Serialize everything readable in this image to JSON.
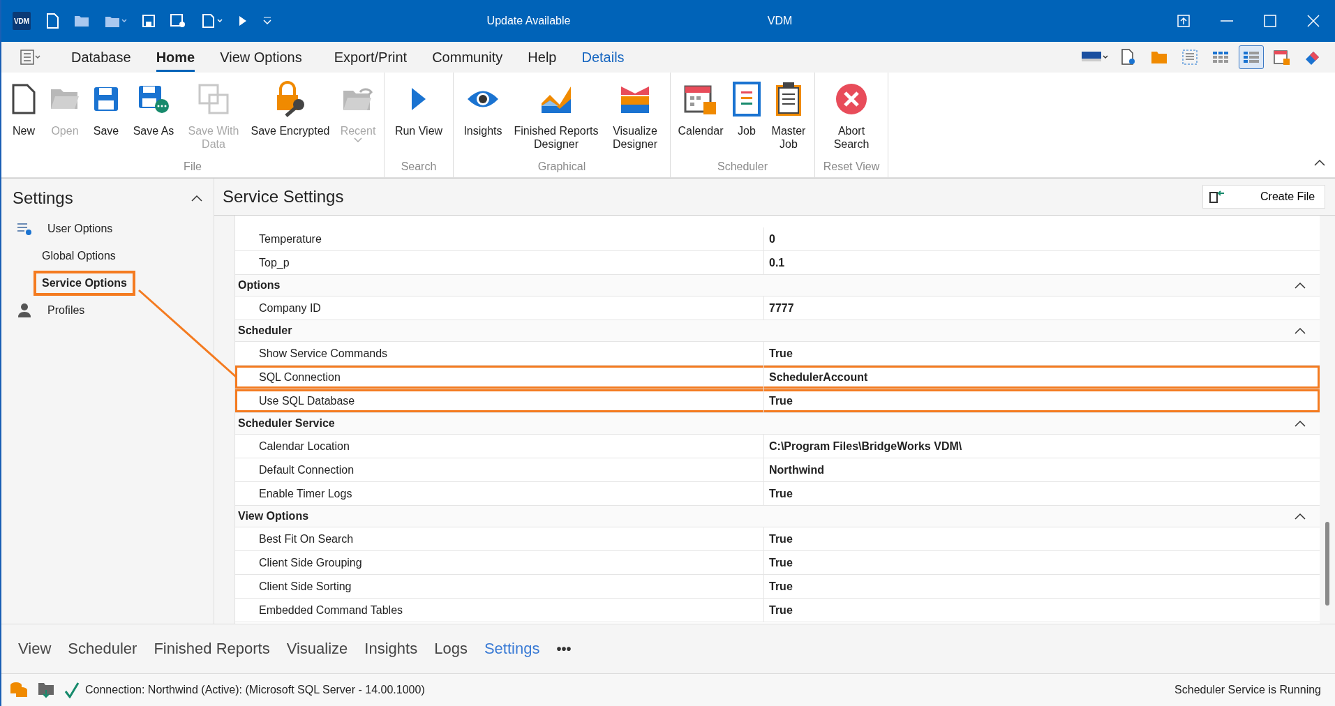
{
  "window": {
    "logo": "VDM",
    "notice": "Update Available",
    "title": "VDM"
  },
  "menu_tabs": [
    {
      "label": "Database",
      "selected": false,
      "kind": "normal"
    },
    {
      "label": "Home",
      "selected": true,
      "kind": "normal"
    },
    {
      "label": "View Options",
      "selected": false,
      "kind": "normal"
    },
    {
      "label": "Export/Print",
      "selected": false,
      "kind": "normal"
    },
    {
      "label": "Community",
      "selected": false,
      "kind": "normal"
    },
    {
      "label": "Help",
      "selected": false,
      "kind": "normal"
    },
    {
      "label": "Details",
      "selected": false,
      "kind": "contextual"
    }
  ],
  "ribbon": [
    {
      "label": "File",
      "buttons": [
        {
          "label": "New",
          "disabled": false
        },
        {
          "label": "Open",
          "disabled": true
        },
        {
          "label": "Save",
          "disabled": false
        },
        {
          "label": "Save As",
          "disabled": false
        },
        {
          "label": "Save With Data",
          "disabled": true
        },
        {
          "label": "Save Encrypted",
          "disabled": false
        },
        {
          "label": "Recent",
          "disabled": true
        }
      ]
    },
    {
      "label": "Search",
      "buttons": [
        {
          "label": "Run View",
          "disabled": false
        }
      ]
    },
    {
      "label": "Graphical",
      "buttons": [
        {
          "label": "Insights",
          "disabled": false
        },
        {
          "label": "Finished Reports Designer",
          "disabled": false
        },
        {
          "label": "Visualize Designer",
          "disabled": false
        }
      ]
    },
    {
      "label": "Scheduler",
      "buttons": [
        {
          "label": "Calendar",
          "disabled": false
        },
        {
          "label": "Job",
          "disabled": false
        },
        {
          "label": "Master Job",
          "disabled": false
        }
      ]
    },
    {
      "label": "Reset View",
      "buttons": [
        {
          "label": "Abort Search",
          "disabled": false
        }
      ]
    }
  ],
  "sidebar": {
    "title": "Settings",
    "items": [
      {
        "label": "User Options",
        "selected": false,
        "children": [
          {
            "label": "Global Options",
            "selected": false
          },
          {
            "label": "Service Options",
            "selected": true
          }
        ]
      },
      {
        "label": "Profiles",
        "selected": false
      }
    ]
  },
  "panel": {
    "title": "Service Settings",
    "create_button": "Create File",
    "groups": [
      {
        "rows": [
          {
            "name": "Temperature",
            "value": "0",
            "highlighted": false
          },
          {
            "name": "Top_p",
            "value": "0.1",
            "highlighted": false
          }
        ]
      },
      {
        "label": "Options",
        "rows": [
          {
            "name": "Company ID",
            "value": "7777",
            "highlighted": false
          }
        ]
      },
      {
        "label": "Scheduler",
        "rows": [
          {
            "name": "Show Service Commands",
            "value": "True",
            "highlighted": false
          },
          {
            "name": "SQL Connection",
            "value": "SchedulerAccount",
            "highlighted": true
          },
          {
            "name": "Use SQL Database",
            "value": "True",
            "highlighted": true
          }
        ]
      },
      {
        "label": "Scheduler Service",
        "rows": [
          {
            "name": "Calendar Location",
            "value": "C:\\Program Files\\BridgeWorks VDM\\",
            "highlighted": false
          },
          {
            "name": "Default Connection",
            "value": "Northwind",
            "highlighted": false
          },
          {
            "name": "Enable Timer Logs",
            "value": "True",
            "highlighted": false
          }
        ]
      },
      {
        "label": "View Options",
        "rows": [
          {
            "name": "Best Fit On Search",
            "value": "True",
            "highlighted": false
          },
          {
            "name": "Client Side Grouping",
            "value": "True",
            "highlighted": false
          },
          {
            "name": "Client Side Sorting",
            "value": "True",
            "highlighted": false
          },
          {
            "name": "Embedded Command Tables",
            "value": "True",
            "highlighted": false
          }
        ]
      }
    ]
  },
  "bottom_tabs": [
    {
      "label": "View",
      "selected": false
    },
    {
      "label": "Scheduler",
      "selected": false
    },
    {
      "label": "Finished Reports",
      "selected": false
    },
    {
      "label": "Visualize",
      "selected": false
    },
    {
      "label": "Insights",
      "selected": false
    },
    {
      "label": "Logs",
      "selected": false
    },
    {
      "label": "Settings",
      "selected": true
    }
  ],
  "more_button": "•••",
  "status_bar": {
    "connection": "Connection: Northwind (Active): (Microsoft SQL Server - 14.00.1000)",
    "service": "Scheduler Service is Running"
  }
}
